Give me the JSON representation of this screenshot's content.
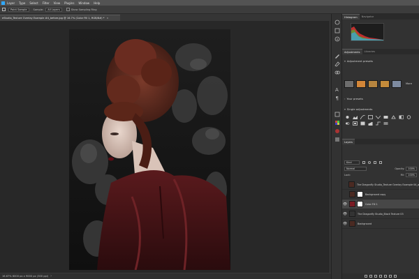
{
  "menubar": {
    "items": [
      "Layer",
      "Type",
      "Select",
      "Filter",
      "View",
      "Plugins",
      "Window",
      "Help"
    ]
  },
  "options": {
    "select_value": "Point Sample",
    "sample_label": "Sample:",
    "sample_value": "All Layers",
    "ring_label": "Show Sampling Ring"
  },
  "document": {
    "tab_title": "eStudio_Texture Overlay Example #4_before.jpg @ 16.7% (Color Fill 1, RGB/8#) *",
    "close_glyph": "×"
  },
  "status": {
    "text": "16.67%  6000 px x 9000 px (300 ppi)",
    "chevron": "›"
  },
  "panels": {
    "top_tabs": [
      "Histogram",
      "Navigator"
    ],
    "mid_tabs": [
      "Adjustments",
      "Libraries"
    ],
    "adjustment_presets_title": "Adjustment presets",
    "more_label": "More",
    "your_presets_title": "Your presets",
    "single_adjustments_title": "Single adjustments",
    "layers_tab": "Layers",
    "filter_kind": "Kind",
    "blend_mode": "Normal",
    "opacity_label": "Opacity:",
    "opacity_value": "100%",
    "lock_label": "Lock:",
    "fill_label": "Fill:",
    "fill_value": "100%"
  },
  "layers": [
    {
      "name": "The Dragonfly Studio_Texture Overlay Example 04_after",
      "thumb": "portrait",
      "mask": false,
      "visible": false,
      "selected": false
    },
    {
      "name": "Background copy",
      "thumb": "portrait",
      "mask": true,
      "visible": false,
      "selected": false
    },
    {
      "name": "Color Fill 1",
      "thumb": "maroon",
      "mask": true,
      "visible": true,
      "selected": true
    },
    {
      "name": "The Dragonfly Studio_Black Texture 03",
      "thumb": "texture",
      "mask": false,
      "visible": true,
      "selected": false
    },
    {
      "name": "Background",
      "thumb": "portrait",
      "mask": false,
      "visible": true,
      "selected": false
    }
  ],
  "colors": {
    "maroon": "#7a1b24",
    "accent": "#31a8ff"
  }
}
